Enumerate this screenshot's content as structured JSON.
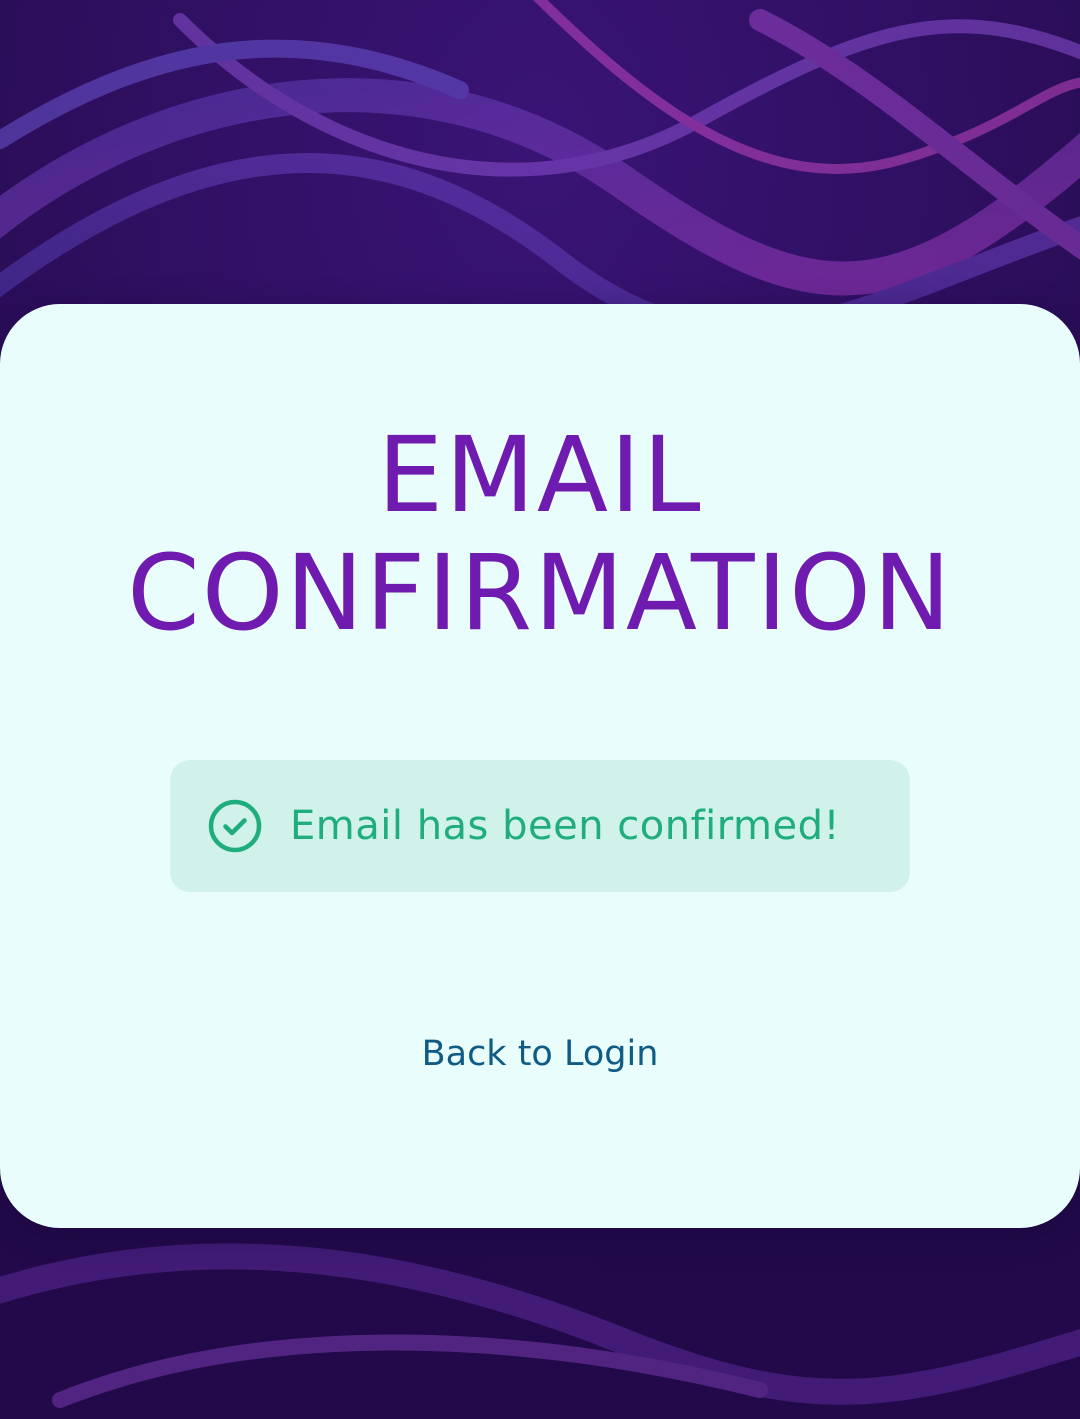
{
  "page": {
    "title_lines": [
      "EMAIL",
      "CONFIRMATION"
    ]
  },
  "alert": {
    "message": "Email has been confirmed!",
    "icon": "check-circle-icon",
    "status": "success"
  },
  "actions": {
    "back_to_login_label": "Back to Login"
  },
  "colors": {
    "title": "#6f1bb0",
    "success_text": "#1fad7e",
    "success_bg": "#d0f2ea",
    "link": "#0f5b86",
    "card_bg": "#e9fdfd",
    "background": "#2a0c55"
  }
}
